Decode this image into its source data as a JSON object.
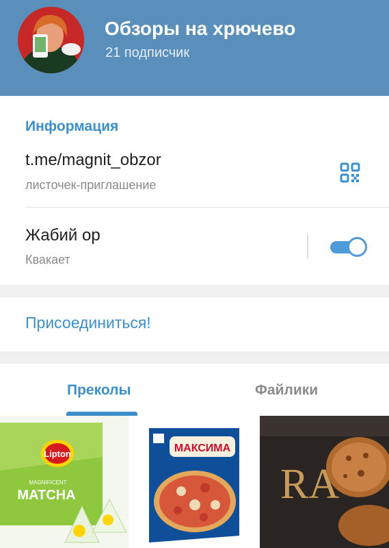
{
  "header": {
    "title": "Обзоры на хрючево",
    "subtitle": "21 подписчик",
    "background_color": "#5a8fbb"
  },
  "info": {
    "section_title": "Информация",
    "link": "t.me/magnit_obzor",
    "link_caption": "листочек-приглашение",
    "qr_icon": "qr-code-icon",
    "toggle_title": "Жабий ор",
    "toggle_caption": "Квакает",
    "toggle_on": true
  },
  "join": {
    "label": "Присоединиться!"
  },
  "tabs": [
    {
      "label": "Преколы",
      "active": true
    },
    {
      "label": "Файлики",
      "active": false
    }
  ],
  "media": [
    {
      "name": "lipton-matcha-photo",
      "brand_text": "Lipton",
      "product_text": "MATCHA",
      "sub_text": "MAGNIFICENT"
    },
    {
      "name": "maxima-pizza-photo",
      "brand_text": "МАКСИМА"
    },
    {
      "name": "cookies-photo",
      "brand_text": "RA"
    }
  ],
  "colors": {
    "accent": "#3d8fcb",
    "switch": "#4f9ad8"
  }
}
